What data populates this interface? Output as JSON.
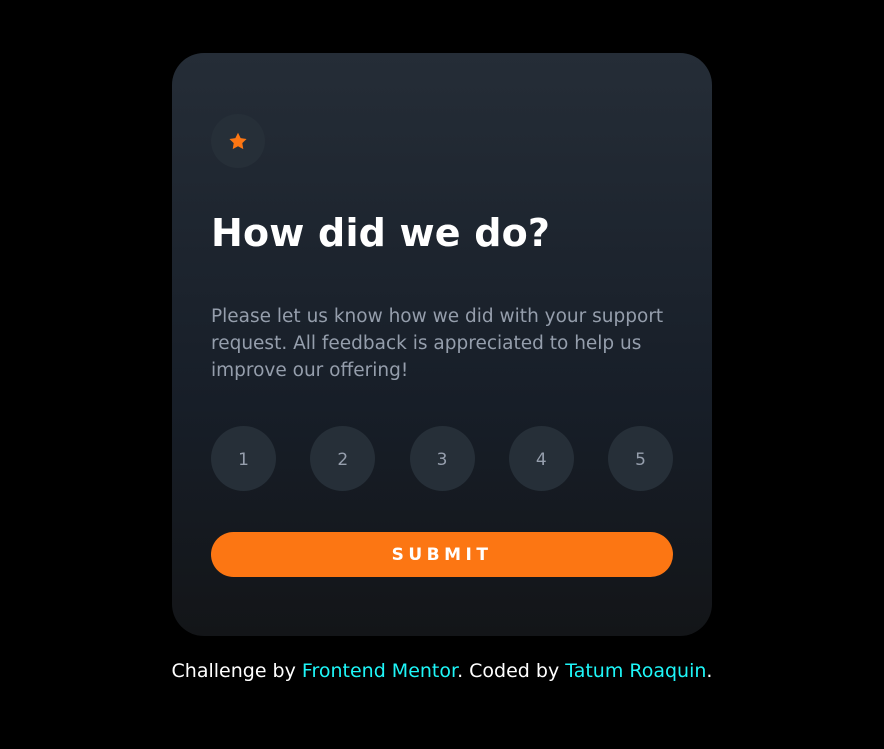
{
  "card": {
    "icon": "star-icon",
    "title": "How did we do?",
    "description": "Please let us know how we did with your support request. All feedback is appreciated to help us improve our offering!",
    "ratings": [
      "1",
      "2",
      "3",
      "4",
      "5"
    ],
    "submit_label": "SUBMIT"
  },
  "attribution": {
    "prefix": "Challenge by ",
    "link1": "Frontend Mentor",
    "middle": ". Coded by ",
    "link2": "Tatum Roaquin",
    "suffix": "."
  },
  "colors": {
    "background": "#000000",
    "card_top": "#252d37",
    "card_bottom": "#131518",
    "accent": "#fc7613",
    "circle": "#262f38",
    "muted_text": "#959eac",
    "link": "#1ef6f8"
  }
}
